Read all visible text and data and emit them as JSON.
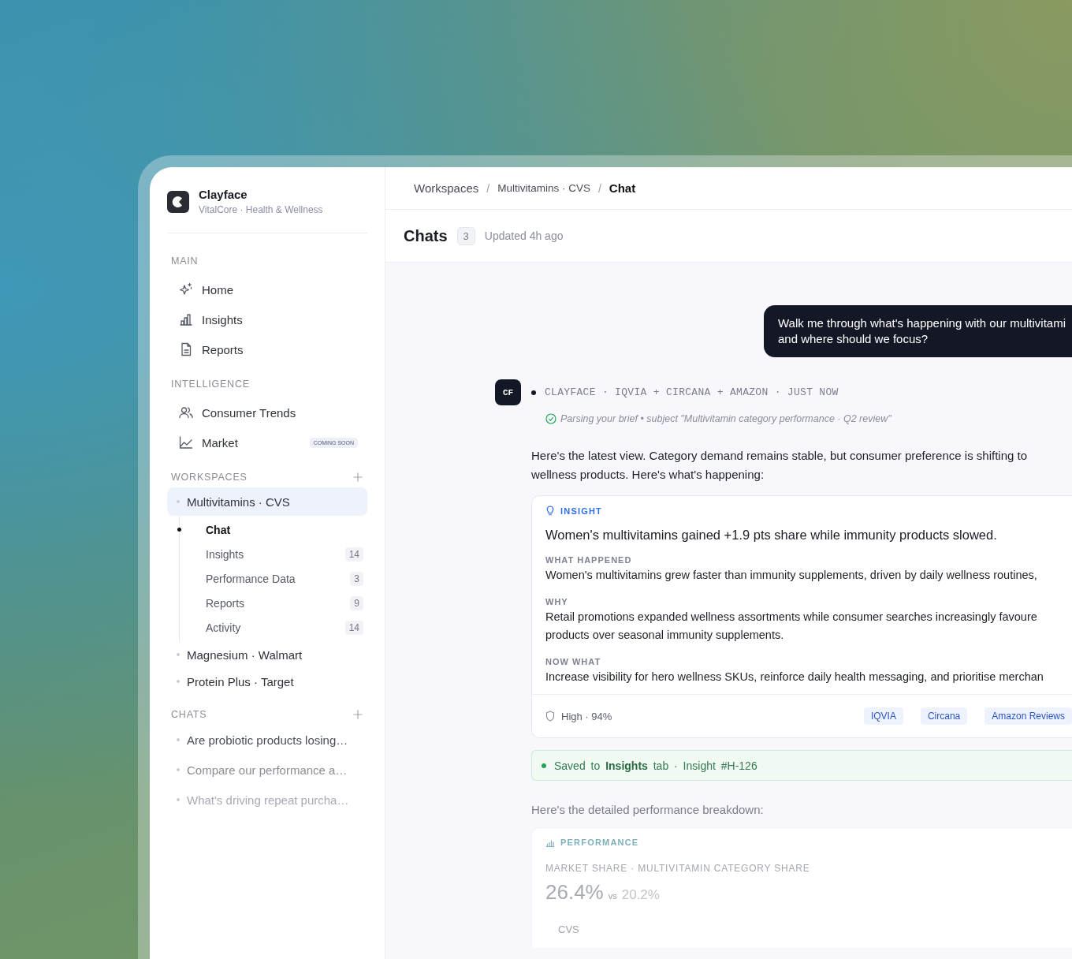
{
  "brand": {
    "name": "Clayface",
    "subtitle": "VitalCore · Health & Wellness"
  },
  "sidebar": {
    "sections": [
      {
        "title": "MAIN",
        "items": [
          {
            "label": "Home",
            "selected": false
          },
          {
            "label": "Insights",
            "selected": false
          },
          {
            "label": "Reports",
            "selected": false
          }
        ]
      },
      {
        "title": "INTELLIGENCE",
        "items": [
          {
            "label": "Consumer Trends",
            "selected": false
          },
          {
            "label": "Market",
            "selected": false,
            "badge": "COMING SOON"
          }
        ]
      }
    ],
    "workspaces": {
      "title": "WORKSPACES",
      "items": [
        {
          "label": "Multivitamins · CVS",
          "selected": true,
          "children": [
            {
              "label": "Chat",
              "selected": true
            },
            {
              "label": "Insights",
              "count": "14",
              "selected": false
            },
            {
              "label": "Performance Data",
              "count": "3",
              "selected": false
            },
            {
              "label": "Reports",
              "count": "9",
              "selected": false
            },
            {
              "label": "Activity",
              "count": "14",
              "selected": false
            }
          ]
        },
        {
          "label": "Magnesium · Walmart",
          "selected": false
        },
        {
          "label": "Protein Plus · Target",
          "selected": false
        }
      ]
    },
    "chats": {
      "title": "CHATS",
      "items": [
        {
          "label": "Are probiotic products losing…",
          "selected": false
        },
        {
          "label": "Compare our performance a…",
          "selected": false
        },
        {
          "label": "What's driving repeat purcha…",
          "selected": false
        }
      ]
    }
  },
  "breadcrumb": {
    "separator": "/",
    "items": [
      {
        "label": "Workspaces",
        "current": false
      },
      {
        "label": "Multivitamins · CVS",
        "current": false
      },
      {
        "label": "Chat",
        "current": true
      }
    ]
  },
  "header": {
    "title": "Chats",
    "count": "3",
    "updated": "Updated 4h ago"
  },
  "user_message": {
    "lines": [
      "Walk me through what's happening with our multivitami",
      "and where should we focus?"
    ]
  },
  "assistant": {
    "avatar": "CF",
    "meta": "CLAYFACE · IQVIA + CIRCANA + AMAZON · JUST NOW",
    "status": "Parsing your brief • subject \"Multivitamin category performance · Q2 review\"",
    "intro": [
      "Here's the latest view. Category demand remains stable, but consumer preference is shifting to",
      "wellness products. Here's what's happening:"
    ]
  },
  "insight": {
    "label": "INSIGHT",
    "headline": "Women's multivitamins gained +1.9 pts share while immunity products slowed.",
    "sections": [
      {
        "heading": "WHAT HAPPENED",
        "lines": [
          "Women's multivitamins grew faster than immunity supplements, driven by daily wellness routines,"
        ]
      },
      {
        "heading": "WHY",
        "lines": [
          "Retail promotions expanded wellness assortments while consumer searches increasingly favoure",
          "products over seasonal immunity supplements."
        ]
      },
      {
        "heading": "NOW WHAT",
        "lines": [
          "Increase visibility for hero wellness SKUs, reinforce daily health messaging, and prioritise merchan"
        ]
      }
    ],
    "confidence": "High · 94%",
    "sources": [
      "IQVIA",
      "Circana",
      "Amazon Reviews"
    ]
  },
  "saved": "Saved to **Insights** tab · Insight #H-126",
  "breakdown_intro": "Here's the detailed performance breakdown:",
  "performance": {
    "label": "PERFORMANCE",
    "metric_label": "MARKET SHARE · MULTIVITAMIN CATEGORY SHARE",
    "value": "26.4%",
    "vs": "vs",
    "comparison": "20.2%",
    "footer": "CVS"
  }
}
